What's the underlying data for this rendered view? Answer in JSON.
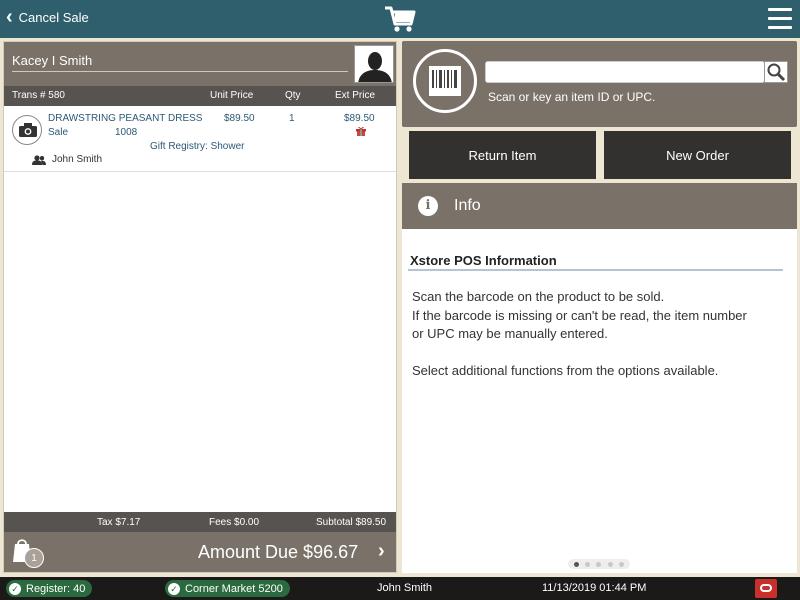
{
  "header": {
    "cancel_label": "Cancel Sale"
  },
  "customer": {
    "name": "Kacey I Smith"
  },
  "transaction": {
    "trans_label": "Trans # 580",
    "columns": {
      "unit_price": "Unit Price",
      "qty": "Qty",
      "ext_price": "Ext Price"
    },
    "items": [
      {
        "description": "DRAWSTRING PEASANT DRESS",
        "type": "Sale",
        "item_number": "1008",
        "unit_price": "$89.50",
        "qty": "1",
        "ext_price": "$89.50",
        "gift_registry": "Gift Registry:  Shower",
        "associate": "John Smith"
      }
    ],
    "totals": {
      "tax": "Tax $7.17",
      "fees": "Fees $0.00",
      "subtotal": "Subtotal $89.50"
    },
    "bag_count": "1",
    "amount_due": "Amount Due  $96.67"
  },
  "scan": {
    "value": "",
    "hint": "Scan or key an item ID or UPC."
  },
  "actions": {
    "return_item": "Return Item",
    "new_order": "New Order"
  },
  "info": {
    "title": "Info",
    "heading": "Xstore POS Information",
    "lines": [
      "Scan the barcode on the product to be sold.",
      "If the barcode is missing or can't be read, the item number",
      "or UPC may be manually entered."
    ],
    "extra": "Select additional functions from the options available.",
    "page_index": 1,
    "page_count": 5
  },
  "status": {
    "register": "Register: 40",
    "store": "Corner Market 5200",
    "user": "John Smith",
    "datetime": "11/13/2019 01:44 PM"
  },
  "colors": {
    "header": "#2f5f6c",
    "panel": "#7a7268",
    "status_pill": "#2a6a3e",
    "brand": "#c9302c"
  }
}
